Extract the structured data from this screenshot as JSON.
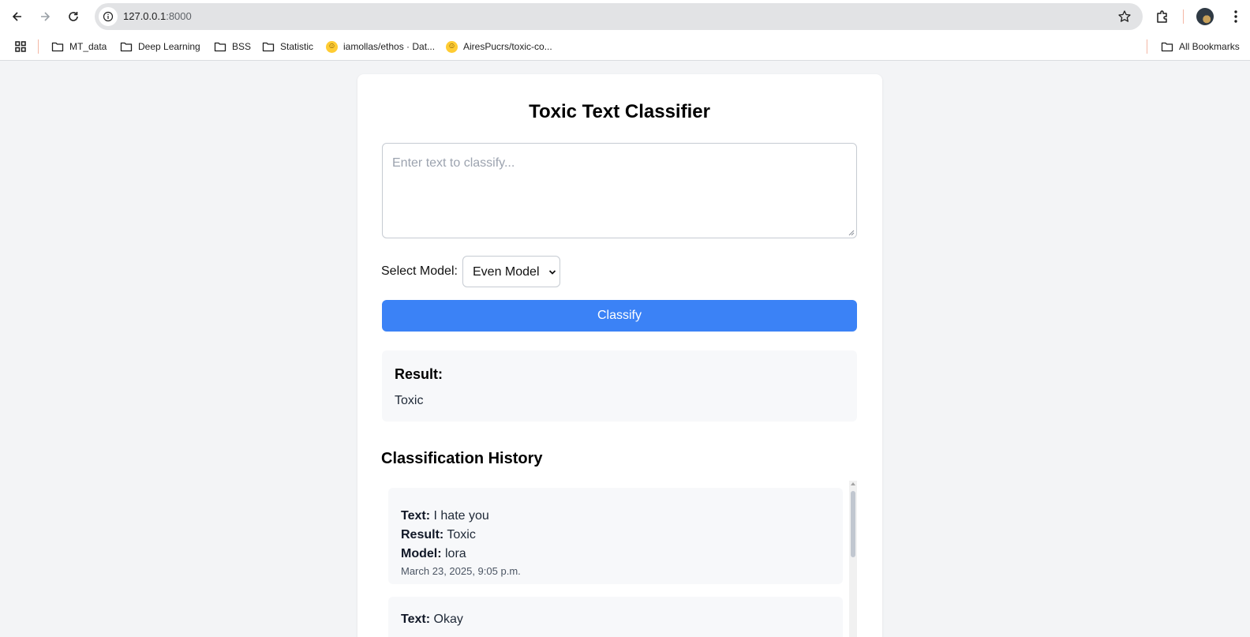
{
  "browser": {
    "url_host": "127.0.0.1",
    "url_port": ":8000",
    "bookmarks": [
      {
        "label": "MT_data",
        "kind": "folder"
      },
      {
        "label": "Deep Learning",
        "kind": "folder"
      },
      {
        "label": "BSS",
        "kind": "folder"
      },
      {
        "label": "Statistic",
        "kind": "folder"
      },
      {
        "label": "iamollas/ethos · Dat...",
        "kind": "huggingface"
      },
      {
        "label": "AiresPucrs/toxic-co...",
        "kind": "huggingface"
      }
    ],
    "all_bookmarks_label": "All Bookmarks"
  },
  "page": {
    "title": "Toxic Text Classifier",
    "text_input": {
      "value": "",
      "placeholder": "Enter text to classify..."
    },
    "model_select": {
      "label": "Select Model:",
      "selected": "Even Model"
    },
    "classify_button": "Classify",
    "result": {
      "heading": "Result:",
      "value": "Toxic"
    },
    "history": {
      "heading": "Classification History",
      "text_label": "Text:",
      "result_label": "Result:",
      "model_label": "Model:",
      "items": [
        {
          "text": "I hate you",
          "result": "Toxic",
          "model": "lora",
          "date": "March 23, 2025, 9:05 p.m."
        },
        {
          "text": "Okay",
          "result": "",
          "model": "",
          "date": ""
        }
      ]
    }
  },
  "colors": {
    "accent": "#3b82f6",
    "page_bg": "#f3f4f6",
    "card_bg": "#ffffff",
    "panel_bg": "#f7f8fa"
  }
}
